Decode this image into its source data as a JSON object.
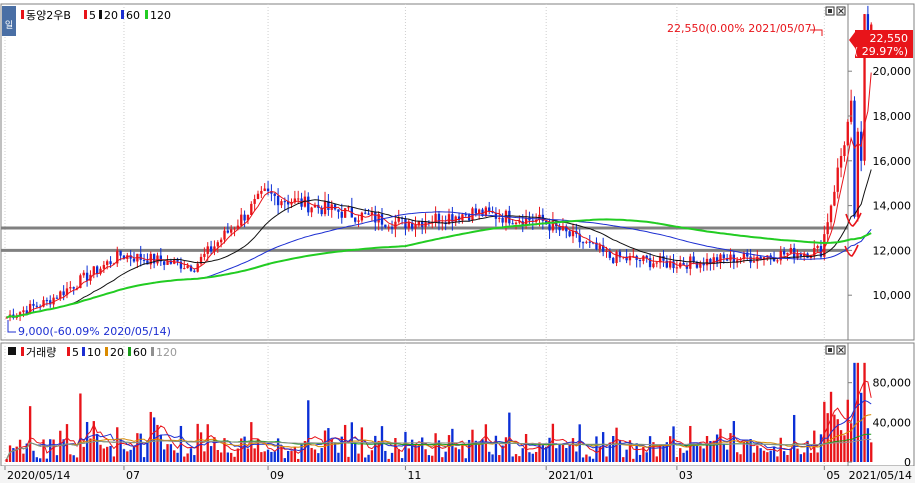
{
  "colors": {
    "up": "#e8141a",
    "down": "#0b2fd6",
    "ma5": "#e8141a",
    "ma20": "#111111",
    "ma60": "#1d2fd2",
    "ma120": "#22cc22",
    "vol_ma5": "#e8141a",
    "vol_ma10": "#1d2fd2",
    "vol_ma20": "#d98a00",
    "vol_ma60": "#1a9c1a",
    "vol_ma120": "#909090",
    "support_line": "#808080",
    "price_tag_bg": "#e8141a",
    "panel_bg": "#ffffff",
    "axis_bg": "#f4f4f4",
    "border": "#808080"
  },
  "chart_data": [
    {
      "type": "candlestick",
      "title": "동양2우B",
      "legend": [
        "5",
        "20",
        "60",
        "120"
      ],
      "ylim": [
        8000,
        23000
      ],
      "yticks": [
        "10,000",
        "12,000",
        "14,000",
        "16,000",
        "18,000",
        "20,000"
      ],
      "xticks": [
        "2020/05/14",
        "07",
        "09",
        "11",
        "2021/01",
        "03",
        "05"
      ],
      "last_date": "2021/05/14",
      "current_price": "22,550",
      "current_change": "( 29.97%)",
      "high_note": "22,550(0.00% 2021/05/07)",
      "low_note": "9,000(-60.09% 2020/05/14)",
      "support_levels": [
        13000,
        12000
      ],
      "monthly_closes": [
        {
          "month": "2020/05",
          "close": 9700
        },
        {
          "month": "2020/06",
          "close": 11800
        },
        {
          "month": "2020/07",
          "close": 11300
        },
        {
          "month": "2020/08",
          "close": 14500
        },
        {
          "month": "2020/09",
          "close": 13800
        },
        {
          "month": "2020/10",
          "close": 13200
        },
        {
          "month": "2020/11",
          "close": 13700
        },
        {
          "month": "2020/12",
          "close": 13300
        },
        {
          "month": "2021/01",
          "close": 11700
        },
        {
          "month": "2021/02",
          "close": 11400
        },
        {
          "month": "2021/03",
          "close": 11700
        },
        {
          "month": "2021/04",
          "close": 12000
        },
        {
          "month": "2021/05",
          "close": 22550
        }
      ]
    },
    {
      "type": "bar",
      "title": "거래량",
      "legend": [
        "5",
        "10",
        "20",
        "60",
        "120"
      ],
      "ylim": [
        0,
        120000
      ],
      "yticks": [
        "0",
        "40,000",
        "80,000"
      ]
    }
  ]
}
